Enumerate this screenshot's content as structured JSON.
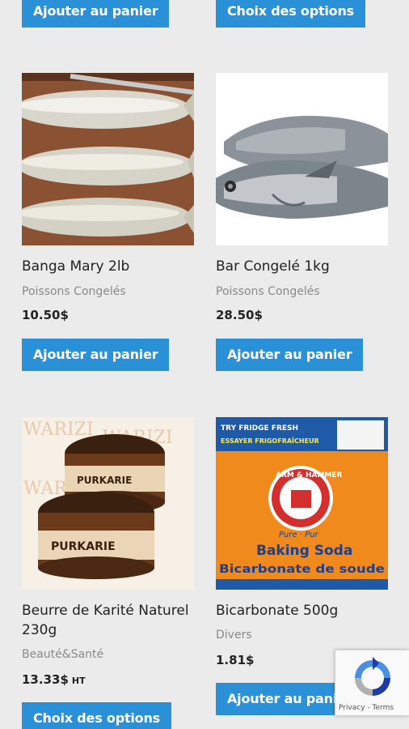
{
  "top_buttons": {
    "left_label": "Ajouter au panier",
    "right_label": "Choix des options"
  },
  "products": [
    {
      "name": "Banga Mary 2lb",
      "category": "Poissons Congelés",
      "price": "10.50$",
      "price_suffix": "",
      "button_label": "Ajouter au panier",
      "image_icon": "frozen-fish-on-board-photo"
    },
    {
      "name": "Bar Congelé 1kg",
      "category": "Poissons Congelés",
      "price": "28.50$",
      "price_suffix": "",
      "button_label": "Ajouter au panier",
      "image_icon": "sea-bass-photo"
    },
    {
      "name": "Beurre de Karité Naturel 230g",
      "category": "Beauté&Santé",
      "price": "13.33$",
      "price_suffix": "HT",
      "button_label": "Choix des options",
      "image_icon": "shea-butter-jars-photo",
      "image_text": [
        "WARIZI",
        "PURKARIE"
      ]
    },
    {
      "name": "Bicarbonate 500g",
      "category": "Divers",
      "price": "1.81$",
      "price_suffix": "",
      "button_label": "Ajouter au panier",
      "image_icon": "baking-soda-box-photo",
      "image_text": [
        "TRY FRIDGE FRESH",
        "ESSAYER FRIGOFRAÎCHEUR",
        "ARM & HAMMER",
        "Pure · Pur",
        "Baking Soda",
        "Bicarbonate de soude"
      ]
    }
  ],
  "recaptcha": {
    "links": "Privacy - Terms"
  },
  "colors": {
    "accent": "#2a90d8",
    "background": "#ebebeb",
    "category_text": "#8a8a8a",
    "title_text": "#222222"
  }
}
